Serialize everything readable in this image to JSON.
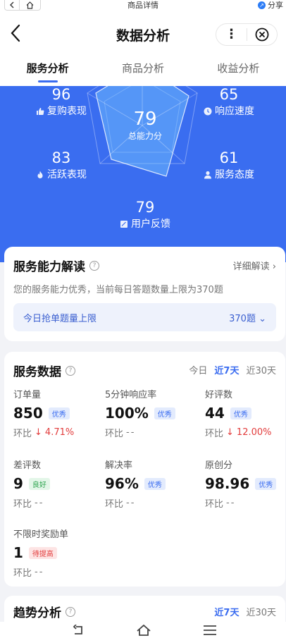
{
  "browser": {
    "title": "商品详情",
    "share_label": "分享"
  },
  "header": {
    "title": "数据分析"
  },
  "tabs": [
    {
      "label": "服务分析",
      "active": true
    },
    {
      "label": "商品分析",
      "active": false
    },
    {
      "label": "收益分析",
      "active": false
    }
  ],
  "hero": {
    "center": {
      "value": "79",
      "label": "总能力分"
    },
    "metrics": {
      "repurchase": {
        "value": "96",
        "label": "复购表现",
        "icon": "thumb-icon"
      },
      "response": {
        "value": "65",
        "label": "响应速度",
        "icon": "clock-icon"
      },
      "activity": {
        "value": "83",
        "label": "活跃表现",
        "icon": "flame-icon"
      },
      "attitude": {
        "value": "61",
        "label": "服务态度",
        "icon": "person-icon"
      },
      "feedback": {
        "value": "79",
        "label": "用户反馈",
        "icon": "note-icon"
      }
    },
    "colors": {
      "background": "#3a6df0"
    }
  },
  "interpretation": {
    "title": "服务能力解读",
    "detail_link": "详细解读",
    "description": "您的服务能力优秀，当前每日答题数量上限为370题",
    "quota_label": "今日抢单题量上限",
    "quota_value": "370题"
  },
  "service_data": {
    "title": "服务数据",
    "ranges": [
      "今日",
      "近7天",
      "近30天"
    ],
    "active_range": "近7天",
    "change_label": "环比",
    "items": [
      {
        "title": "订单量",
        "value": "850",
        "badge": "优秀",
        "badge_color": "blue",
        "change": "4.71%",
        "change_dir": "down"
      },
      {
        "title": "5分钟响应率",
        "value": "100%",
        "badge": "优秀",
        "badge_color": "blue",
        "change": "--",
        "change_dir": "none"
      },
      {
        "title": "好评数",
        "value": "44",
        "badge": "优秀",
        "badge_color": "blue",
        "change": "12.00%",
        "change_dir": "down"
      },
      {
        "title": "差评数",
        "value": "9",
        "badge": "良好",
        "badge_color": "green",
        "change": "--",
        "change_dir": "none"
      },
      {
        "title": "解决率",
        "value": "96%",
        "badge": "优秀",
        "badge_color": "blue",
        "change": "--",
        "change_dir": "none"
      },
      {
        "title": "原创分",
        "value": "98.96",
        "badge": "优秀",
        "badge_color": "blue",
        "change": "--",
        "change_dir": "none"
      },
      {
        "title": "不限时奖励单",
        "value": "1",
        "badge": "待提高",
        "badge_color": "red",
        "change": "--",
        "change_dir": "none"
      }
    ]
  },
  "trend": {
    "title": "趋势分析",
    "ranges": [
      "近7天",
      "近30天"
    ],
    "active_range": "近7天"
  }
}
